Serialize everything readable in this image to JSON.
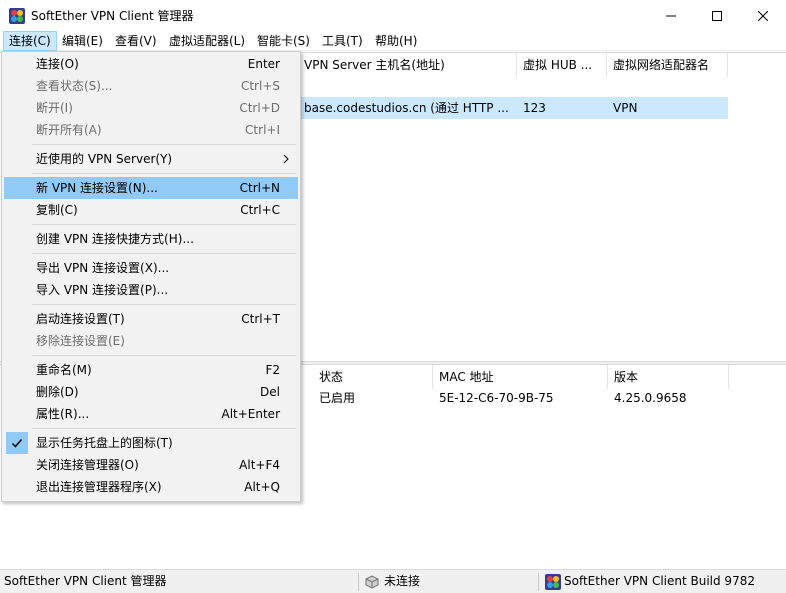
{
  "window": {
    "title": "SoftEther VPN Client 管理器",
    "colors": {
      "accent_selection": "#cce8ff",
      "menu_highlight": "#91c9f7",
      "menu_bg": "#f2f2f2"
    }
  },
  "menubar": {
    "items": [
      "连接(C)",
      "编辑(E)",
      "查看(V)",
      "虚拟适配器(L)",
      "智能卡(S)",
      "工具(T)",
      "帮助(H)"
    ],
    "active_index": 0
  },
  "connections": {
    "headers": [
      "VPN Server 主机名(地址)",
      "虚拟 HUB ...",
      "虚拟网络适配器名"
    ],
    "rows": [
      {
        "host": "base.codestudios.cn (通过 HTTP ...",
        "hub": "123",
        "adapter": "VPN"
      }
    ]
  },
  "adapters": {
    "headers": [
      "状态",
      "MAC 地址",
      "版本"
    ],
    "rows": [
      {
        "status": "已启用",
        "mac": "5E-12-C6-70-9B-75",
        "version": "4.25.0.9658"
      }
    ]
  },
  "dropdown": {
    "items": [
      {
        "label": "连接(O)",
        "shortcut": "Enter",
        "disabled": false
      },
      {
        "label": "查看状态(S)...",
        "shortcut": "Ctrl+S",
        "disabled": true
      },
      {
        "label": "断开(I)",
        "shortcut": "Ctrl+D",
        "disabled": true
      },
      {
        "label": "断开所有(A)",
        "shortcut": "Ctrl+I",
        "disabled": true
      },
      {
        "label": "近使用的 VPN Server(Y)",
        "shortcut": "",
        "disabled": false,
        "submenu": true
      },
      {
        "label": "新 VPN 连接设置(N)...",
        "shortcut": "Ctrl+N",
        "disabled": false,
        "highlighted": true
      },
      {
        "label": "复制(C)",
        "shortcut": "Ctrl+C",
        "disabled": false
      },
      {
        "label": "创建 VPN 连接快捷方式(H)...",
        "shortcut": "",
        "disabled": false
      },
      {
        "label": "导出 VPN 连接设置(X)...",
        "shortcut": "",
        "disabled": false
      },
      {
        "label": "导入 VPN 连接设置(P)...",
        "shortcut": "",
        "disabled": false
      },
      {
        "label": "启动连接设置(T)",
        "shortcut": "Ctrl+T",
        "disabled": false
      },
      {
        "label": "移除连接设置(E)",
        "shortcut": "",
        "disabled": true
      },
      {
        "label": "重命名(M)",
        "shortcut": "F2",
        "disabled": false
      },
      {
        "label": "删除(D)",
        "shortcut": "Del",
        "disabled": false
      },
      {
        "label": "属性(R)...",
        "shortcut": "Alt+Enter",
        "disabled": false
      },
      {
        "label": "显示任务托盘上的图标(T)",
        "shortcut": "",
        "disabled": false,
        "checked": true
      },
      {
        "label": "关闭连接管理器(O)",
        "shortcut": "Alt+F4",
        "disabled": false
      },
      {
        "label": "退出连接管理器程序(X)",
        "shortcut": "Alt+Q",
        "disabled": false
      }
    ]
  },
  "statusbar": {
    "app": "SoftEther VPN Client 管理器",
    "connection": "未连接",
    "build": "SoftEther VPN Client Build 9782"
  }
}
